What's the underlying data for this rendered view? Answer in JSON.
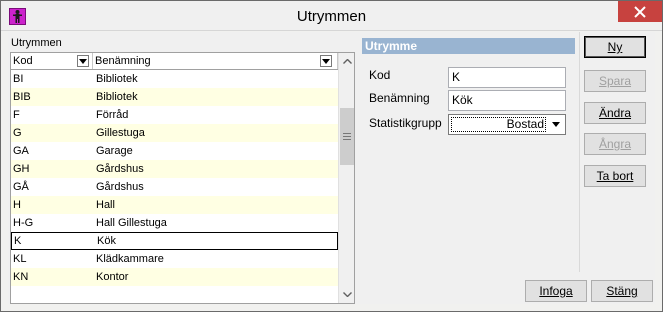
{
  "window": {
    "title": "Utrymmen",
    "close_icon": "close-icon",
    "app_icon": "person-icon"
  },
  "list": {
    "caption": "Utrymmen",
    "columns": [
      "Kod",
      "Benämning"
    ],
    "rows": [
      {
        "kod": "BI",
        "name": "Bibliotek"
      },
      {
        "kod": "BIB",
        "name": "Bibliotek"
      },
      {
        "kod": "F",
        "name": "Förråd"
      },
      {
        "kod": "G",
        "name": "Gillestuga"
      },
      {
        "kod": "GA",
        "name": "Garage"
      },
      {
        "kod": "GH",
        "name": "Gårdshus"
      },
      {
        "kod": "GÅ",
        "name": "Gårdshus"
      },
      {
        "kod": "H",
        "name": "Hall"
      },
      {
        "kod": "H-G",
        "name": "Hall Gillestuga"
      },
      {
        "kod": "K",
        "name": "Kök"
      },
      {
        "kod": "KL",
        "name": "Klädkammare"
      },
      {
        "kod": "KN",
        "name": "Kontor"
      }
    ],
    "selected_index": 9
  },
  "detail": {
    "header": "Utrymme",
    "kod_label": "Kod",
    "kod_value": "K",
    "name_label": "Benämning",
    "name_value": "Kök",
    "stat_label": "Statistikgrupp",
    "stat_value": "Bostad"
  },
  "buttons": {
    "ny": "Ny",
    "spara": "Spara",
    "andra": "Ändra",
    "angra": "Ångra",
    "ta_bort": "Ta bort",
    "infoga": "Infoga",
    "stang": "Stäng"
  },
  "colors": {
    "accent": "#99b4d1",
    "row_alt": "#ffffe3",
    "close": "#c7423f"
  }
}
